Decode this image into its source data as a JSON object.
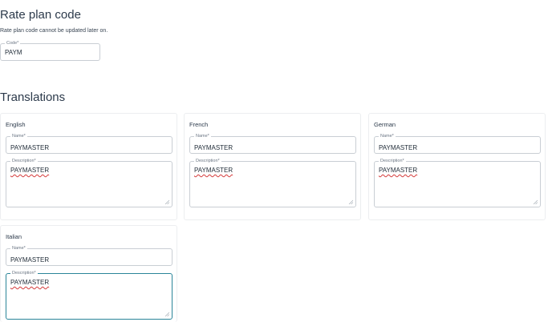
{
  "rate_plan": {
    "title": "Rate plan code",
    "note": "Rate plan code cannot be updated later on.",
    "code_label": "Code*",
    "code_value": "PAYM"
  },
  "translations": {
    "title": "Translations",
    "cards": [
      {
        "language": "English",
        "name_label": "Name*",
        "name_value": "PAYMASTER",
        "desc_label": "Description*",
        "desc_value": "PAYMASTER"
      },
      {
        "language": "French",
        "name_label": "Name*",
        "name_value": "PAYMASTER",
        "desc_label": "Description*",
        "desc_value": "PAYMASTER"
      },
      {
        "language": "German",
        "name_label": "Name*",
        "name_value": "PAYMASTER",
        "desc_label": "Description*",
        "desc_value": "PAYMASTER"
      },
      {
        "language": "Italian",
        "name_label": "Name*",
        "name_value": "PAYMASTER",
        "desc_label": "Description*",
        "desc_value": "PAYMASTER"
      }
    ]
  },
  "colors": {
    "focus_border": "#2a8599",
    "field_border": "#c9ced4",
    "spell_underline": "#d43a3a"
  }
}
